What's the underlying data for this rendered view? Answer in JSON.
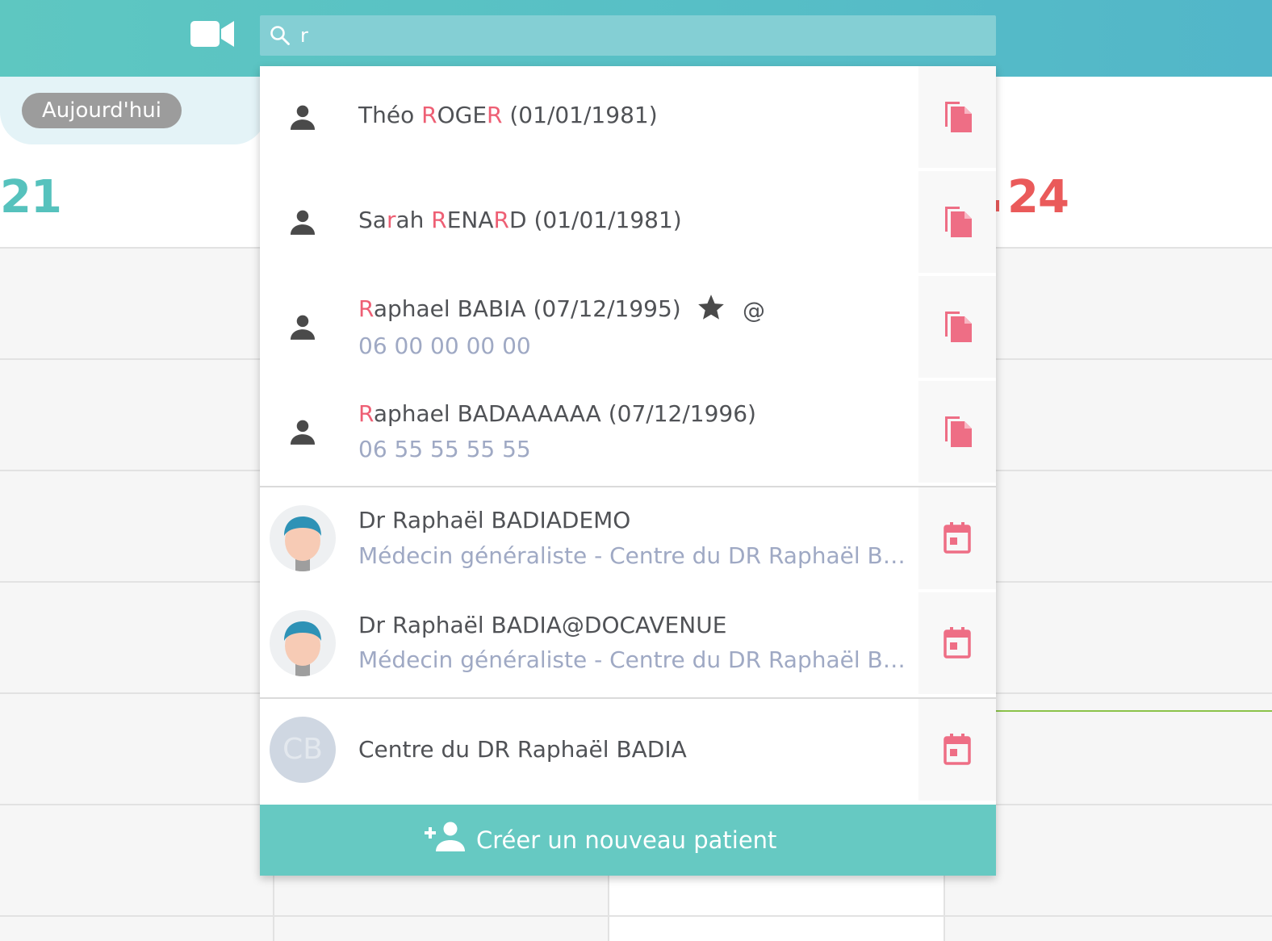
{
  "header": {
    "video_icon": "video-camera-icon",
    "search": {
      "icon": "search-icon",
      "value": "r",
      "placeholder": ""
    }
  },
  "calendar": {
    "today_label": "Aujourd'hui",
    "left_day": "21",
    "right_day": "24",
    "colors": {
      "accent_teal": "#56c2bd",
      "weekend_red": "#ea5a5a",
      "now_line": "#8bc34a"
    }
  },
  "results": {
    "patients": [
      {
        "name_parts": [
          "Théo ",
          "R",
          "OGE",
          "R",
          " (01/01/1981)"
        ],
        "phone": "",
        "starred": false,
        "has_email": false,
        "action_icon": "file-copy-icon"
      },
      {
        "name_parts": [
          "Sa",
          "r",
          "ah ",
          "R",
          "ENA",
          "R",
          "D (01/01/1981)"
        ],
        "phone": "",
        "starred": false,
        "has_email": false,
        "action_icon": "file-copy-icon"
      },
      {
        "name_parts": [
          "R",
          "aphael BABIA (07/12/1995)"
        ],
        "phone": "06 00 00 00 00",
        "starred": true,
        "email_symbol": "@",
        "action_icon": "file-copy-icon"
      },
      {
        "name_parts": [
          "R",
          "aphael BADAAAAAA (07/12/1996)"
        ],
        "phone": "06 55 55 55 55",
        "starred": false,
        "has_email": false,
        "action_icon": "file-copy-icon"
      }
    ],
    "practitioners": [
      {
        "name": "Dr Raphaël BADIADEMO",
        "subtitle": "Médecin généraliste - Centre du DR Raphaël BADIA",
        "action_icon": "calendar-icon"
      },
      {
        "name": "Dr Raphaël BADIA@DOCAVENUE",
        "subtitle": "Médecin généraliste - Centre du DR Raphaël BADIA",
        "action_icon": "calendar-icon"
      }
    ],
    "centers": [
      {
        "initials": "CB",
        "name": "Centre du DR Raphaël BADIA",
        "action_icon": "calendar-icon"
      }
    ],
    "create_button": {
      "label": "Créer un nouveau patient",
      "icon": "person-add-icon"
    },
    "colors": {
      "highlight": "#ee5f74",
      "action": "#ee6e85",
      "secondary_text": "#9fa9c4",
      "footer": "#66c9c2"
    }
  }
}
